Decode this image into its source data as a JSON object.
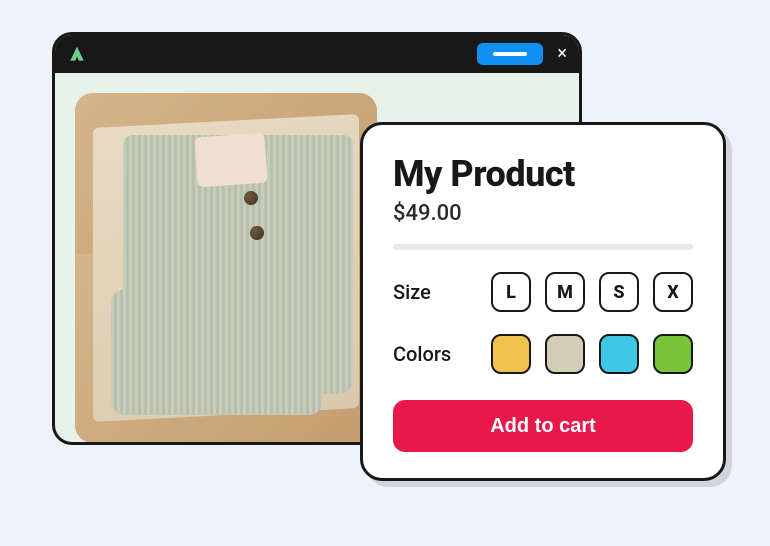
{
  "product": {
    "title": "My Product",
    "price": "$49.00",
    "size_label": "Size",
    "colors_label": "Colors",
    "add_to_cart_label": "Add to cart",
    "sizes": [
      "L",
      "M",
      "S",
      "X"
    ],
    "colors": [
      "#F2C24E",
      "#D3CDB5",
      "#3FC7E6",
      "#7AC43A"
    ]
  }
}
